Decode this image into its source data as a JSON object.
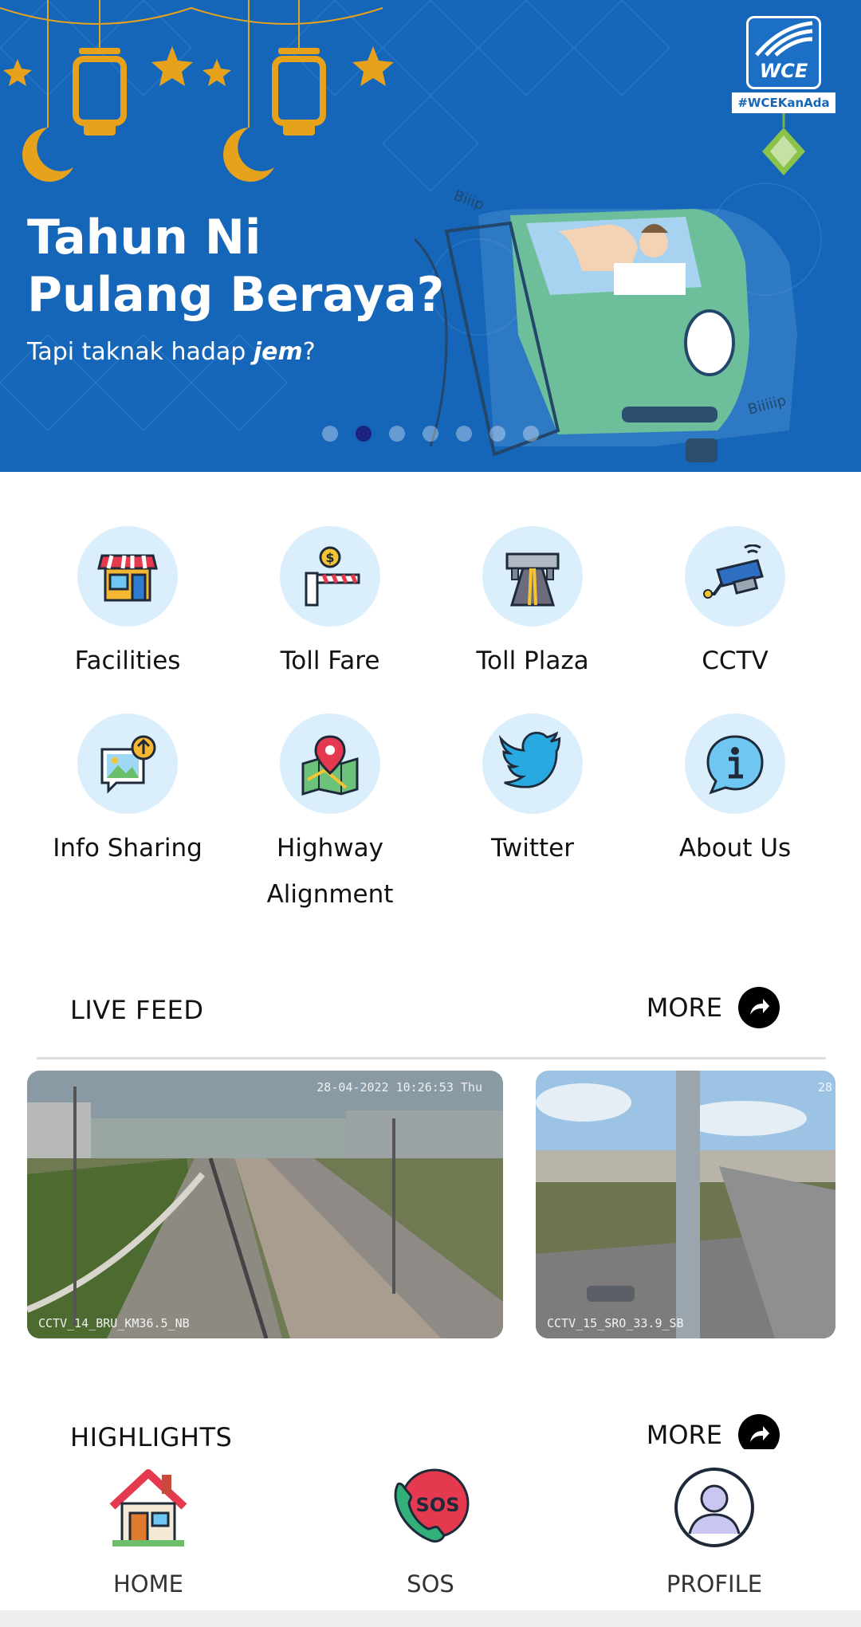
{
  "banner": {
    "title_line1": "Tahun Ni",
    "title_line2": "Pulang Beraya?",
    "subtitle_prefix": "Tapi taknak hadap ",
    "subtitle_emphasis": "jem",
    "subtitle_suffix": "?",
    "logo_text": "WCE",
    "hashtag": "#WCEKanAda",
    "slide_count": 7,
    "active_slide": 2,
    "background_color": "#1566b8"
  },
  "menu": {
    "items": [
      {
        "label": "Facilities",
        "icon": "shop-icon"
      },
      {
        "label": "Toll Fare",
        "icon": "toll-barrier-icon"
      },
      {
        "label": "Toll Plaza",
        "icon": "toll-plaza-icon"
      },
      {
        "label": "CCTV",
        "icon": "cctv-camera-icon"
      },
      {
        "label": "Info Sharing",
        "icon": "image-upload-icon"
      },
      {
        "label": "Highway",
        "label2": "Alignment",
        "icon": "map-pin-icon"
      },
      {
        "label": "Twitter",
        "icon": "twitter-bird-icon"
      },
      {
        "label": "About Us",
        "icon": "info-bubble-icon"
      }
    ]
  },
  "live_feed": {
    "title": "LIVE FEED",
    "more_label": "MORE",
    "cameras": [
      {
        "timestamp": "28-04-2022 10:26:53 Thu",
        "camera_name": "CCTV_14_BRU_KM36.5_NB"
      },
      {
        "timestamp": "28",
        "camera_name": "CCTV_15_SRO_33.9_SB"
      }
    ]
  },
  "highlights": {
    "title": "HIGHLIGHTS",
    "more_label": "MORE"
  },
  "bottom_nav": {
    "items": [
      {
        "label": "HOME",
        "icon": "home-icon"
      },
      {
        "label": "SOS",
        "icon": "sos-phone-icon"
      },
      {
        "label": "PROFILE",
        "icon": "profile-icon"
      }
    ]
  },
  "colors": {
    "accent": "#1566b8",
    "icon_circle": "#dbeefc",
    "active_dot": "#1a237e"
  }
}
